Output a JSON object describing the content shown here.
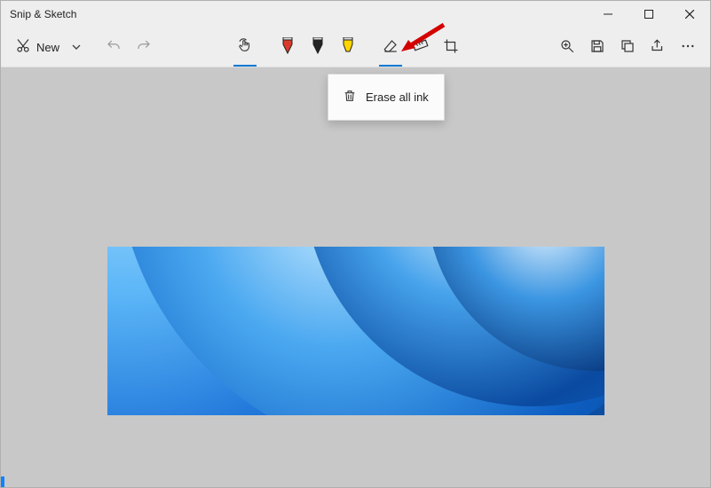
{
  "window": {
    "title": "Snip & Sketch"
  },
  "toolbar": {
    "new_label": "New",
    "touch_active": true,
    "eraser_active": true
  },
  "popup": {
    "erase_all_label": "Erase all ink"
  },
  "colors": {
    "accent": "#0078d4",
    "annotation_arrow": "#d40000"
  }
}
